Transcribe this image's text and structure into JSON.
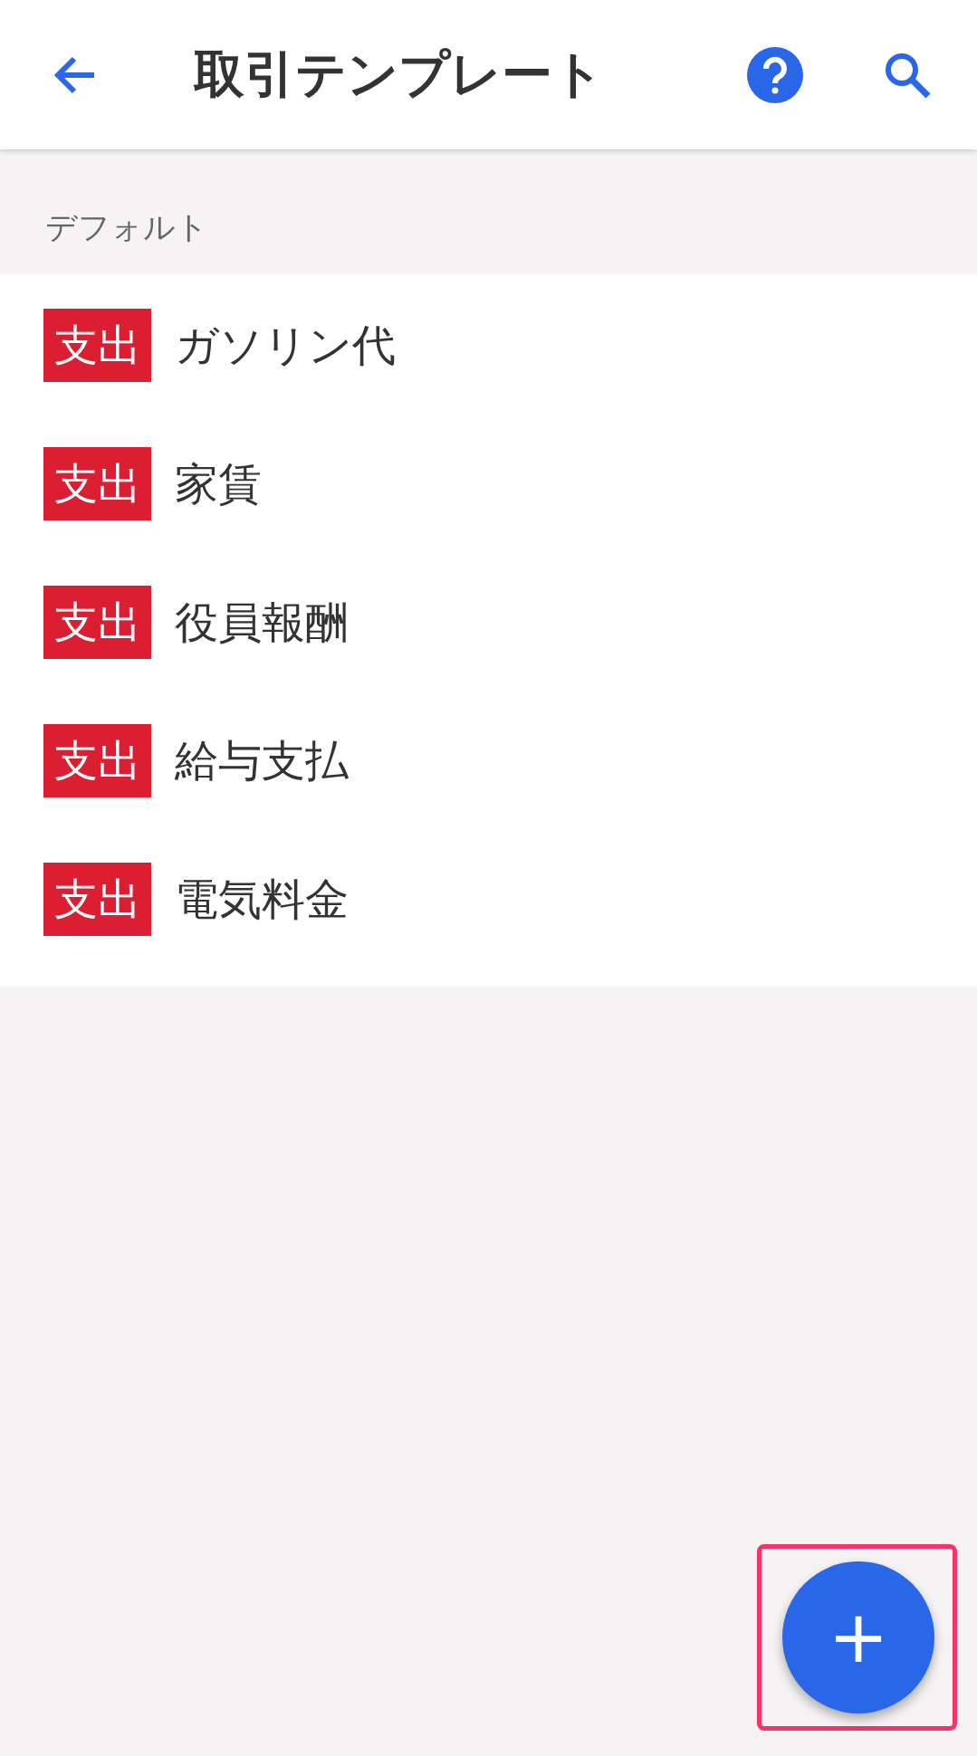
{
  "app_bar": {
    "title": "取引テンプレート"
  },
  "section": {
    "title": "デフォルト"
  },
  "templates": [
    {
      "badge": "支出",
      "name": "ガソリン代"
    },
    {
      "badge": "支出",
      "name": "家賃"
    },
    {
      "badge": "支出",
      "name": "役員報酬"
    },
    {
      "badge": "支出",
      "name": "給与支払"
    },
    {
      "badge": "支出",
      "name": "電気料金"
    }
  ],
  "fab": {
    "symbol": "+",
    "highlighted": true
  }
}
